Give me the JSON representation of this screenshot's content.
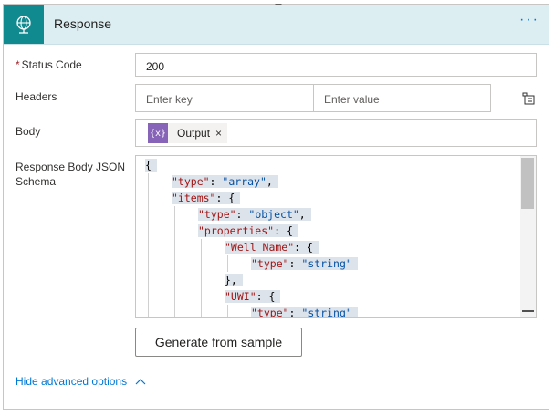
{
  "header": {
    "title": "Response",
    "more_label": "···"
  },
  "fields": {
    "status_code": {
      "label": "Status Code",
      "value": "200"
    },
    "headers": {
      "label": "Headers",
      "key_placeholder": "Enter key",
      "value_placeholder": "Enter value"
    },
    "body": {
      "label": "Body",
      "token": "Output",
      "token_icon": "{x}",
      "remove": "×"
    },
    "schema": {
      "label_line1": "Response Body JSON",
      "label_line2": "Schema",
      "lines": [
        {
          "indent": 0,
          "parts": [
            [
              "{",
              "p"
            ]
          ]
        },
        {
          "indent": 1,
          "parts": [
            [
              "\"type\"",
              "k"
            ],
            [
              ": ",
              "p"
            ],
            [
              "\"array\"",
              "s"
            ],
            [
              ",",
              "p"
            ]
          ]
        },
        {
          "indent": 1,
          "parts": [
            [
              "\"items\"",
              "k"
            ],
            [
              ": {",
              "p"
            ]
          ]
        },
        {
          "indent": 2,
          "parts": [
            [
              "\"type\"",
              "k"
            ],
            [
              ": ",
              "p"
            ],
            [
              "\"object\"",
              "s"
            ],
            [
              ",",
              "p"
            ]
          ]
        },
        {
          "indent": 2,
          "parts": [
            [
              "\"properties\"",
              "k"
            ],
            [
              ": {",
              "p"
            ]
          ]
        },
        {
          "indent": 3,
          "parts": [
            [
              "\"Well Name\"",
              "k"
            ],
            [
              ": {",
              "p"
            ]
          ]
        },
        {
          "indent": 4,
          "parts": [
            [
              "\"type\"",
              "k"
            ],
            [
              ": ",
              "p"
            ],
            [
              "\"string\"",
              "s"
            ]
          ]
        },
        {
          "indent": 3,
          "parts": [
            [
              "},",
              "p"
            ]
          ]
        },
        {
          "indent": 3,
          "parts": [
            [
              "\"UWI\"",
              "k"
            ],
            [
              ": {",
              "p"
            ]
          ]
        },
        {
          "indent": 4,
          "parts": [
            [
              "\"type\"",
              "k"
            ],
            [
              ": ",
              "p"
            ],
            [
              "\"string\"",
              "s"
            ]
          ]
        }
      ]
    }
  },
  "buttons": {
    "generate": "Generate from sample"
  },
  "footer": {
    "advanced": "Hide advanced options"
  },
  "colors": {
    "accent": "#10898f",
    "header_bg": "#ddeef2",
    "link": "#0078d4",
    "token": "#8764b8"
  },
  "icons": {
    "header": "globe-icon",
    "headers_action": "switch-to-text-mode-icon",
    "more": "ellipsis-icon",
    "footer": "chevron-up-icon"
  }
}
